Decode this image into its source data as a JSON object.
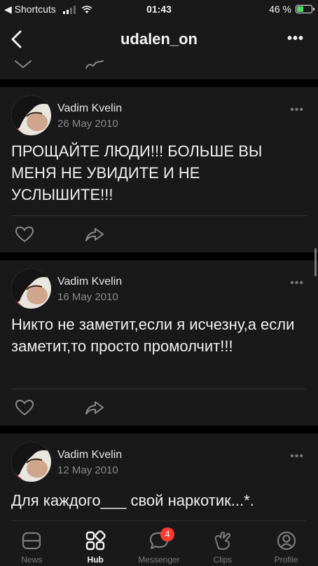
{
  "status_bar": {
    "back_label": "◀ Shortcuts",
    "time": "01:43",
    "battery_percent": "46 %",
    "battery_level": 0.46,
    "signal_bars": 2
  },
  "header": {
    "title": "udalen_on",
    "back_icon": "chevron-left-icon",
    "more_icon": "more-icon",
    "more_label": "•••"
  },
  "posts": [
    {
      "author": "Vadim Kvelin",
      "date": "26 May 2010",
      "text": "ПРОЩАЙТЕ ЛЮДИ!!! БОЛЬШЕ ВЫ МЕНЯ НЕ УВИДИТЕ И НЕ УСЛЫШИТЕ!!!"
    },
    {
      "author": "Vadim Kvelin",
      "date": "16 May 2010",
      "text": "Никто не заметит,если я исчезну,а если заметит,то просто промолчит!!!"
    },
    {
      "author": "Vadim Kvelin",
      "date": "12 May 2010",
      "text": "Для каждого___ свой наркотик...*."
    }
  ],
  "post_more_label": "•••",
  "tabs": [
    {
      "label": "News",
      "icon": "news-icon"
    },
    {
      "label": "Hub",
      "icon": "hub-icon",
      "active": true
    },
    {
      "label": "Messenger",
      "icon": "messenger-icon",
      "badge": "4"
    },
    {
      "label": "Clips",
      "icon": "clips-icon"
    },
    {
      "label": "Profile",
      "icon": "profile-icon"
    }
  ],
  "colors": {
    "background": "#000000",
    "card": "#191919",
    "badge": "#ff3b30",
    "battery_fill": "#4cd964"
  }
}
